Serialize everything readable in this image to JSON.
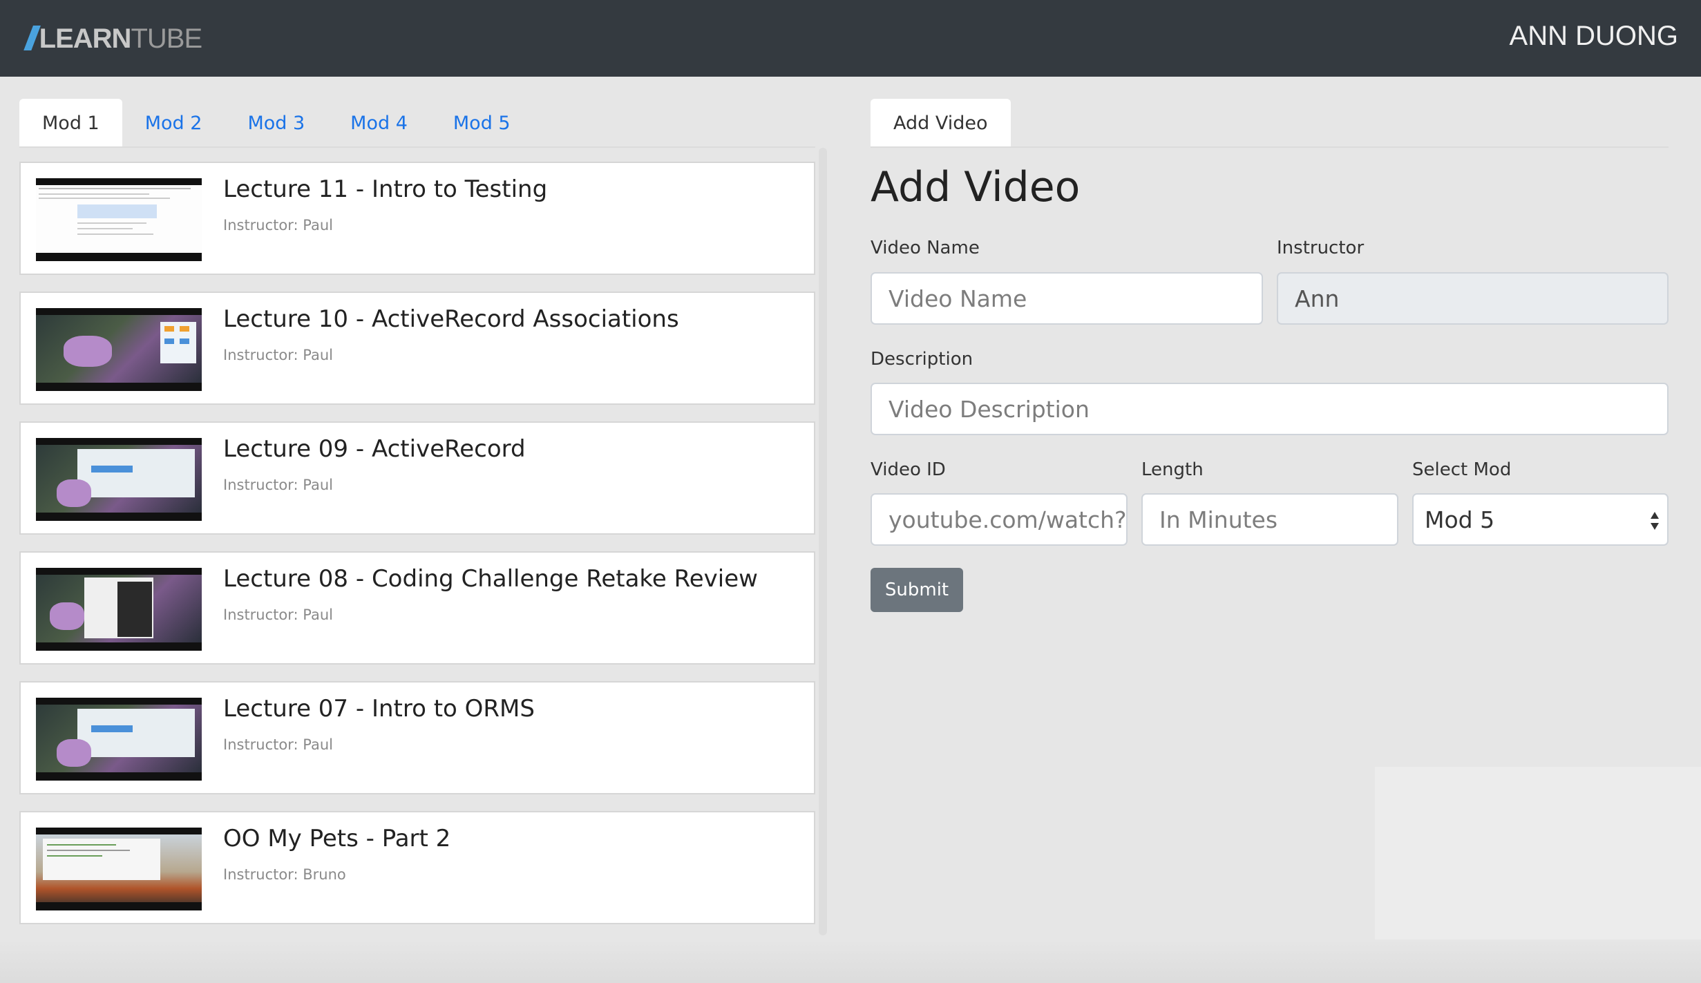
{
  "header": {
    "logo_slash": "//",
    "logo_learn": "LEARN",
    "logo_tube": "TUBE",
    "user_name": "ANN DUONG"
  },
  "mod_tabs": [
    {
      "label": "Mod 1",
      "active": true
    },
    {
      "label": "Mod 2",
      "active": false
    },
    {
      "label": "Mod 3",
      "active": false
    },
    {
      "label": "Mod 4",
      "active": false
    },
    {
      "label": "Mod 5",
      "active": false
    }
  ],
  "videos": [
    {
      "title": "Lecture 11 - Intro to Testing",
      "instructor": "Instructor: Paul"
    },
    {
      "title": "Lecture 10 - ActiveRecord Associations",
      "instructor": "Instructor: Paul"
    },
    {
      "title": "Lecture 09 - ActiveRecord",
      "instructor": "Instructor: Paul"
    },
    {
      "title": "Lecture 08 - Coding Challenge Retake Review",
      "instructor": "Instructor: Paul"
    },
    {
      "title": "Lecture 07 - Intro to ORMS",
      "instructor": "Instructor: Paul"
    },
    {
      "title": "OO My Pets - Part 2",
      "instructor": "Instructor: Bruno"
    }
  ],
  "form": {
    "tab_label": "Add Video",
    "title": "Add Video",
    "video_name": {
      "label": "Video Name",
      "placeholder": "Video Name",
      "value": ""
    },
    "instructor": {
      "label": "Instructor",
      "value": "Ann"
    },
    "description": {
      "label": "Description",
      "placeholder": "Video Description",
      "value": ""
    },
    "video_id": {
      "label": "Video ID",
      "placeholder": "youtube.com/watch?v",
      "value": ""
    },
    "length": {
      "label": "Length",
      "placeholder": "In Minutes",
      "value": ""
    },
    "select_mod": {
      "label": "Select Mod",
      "value": "Mod 5"
    },
    "submit_label": "Submit"
  },
  "colors": {
    "header_bg": "#343a40",
    "page_bg": "#e6e6e6",
    "tab_link": "#1a73e8",
    "logo_accent": "#4aa3df",
    "submit_bg": "#6c757d"
  }
}
